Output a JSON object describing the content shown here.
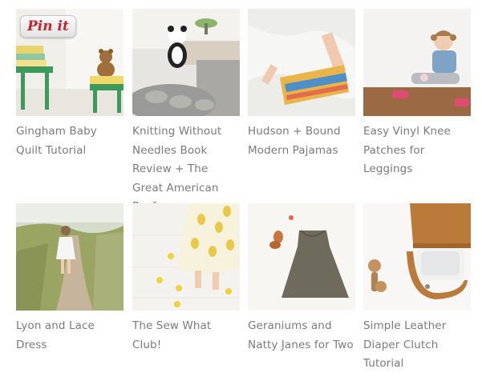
{
  "pin_button": {
    "label": "Pin it"
  },
  "cards": [
    {
      "title": "Gingham Baby Quilt Tutorial"
    },
    {
      "title": "Knitting Without Needles Book Review + The Great American Pouf"
    },
    {
      "title": "Hudson + Bound Modern Pajamas"
    },
    {
      "title": "Easy Vinyl Knee Patches for Leggings"
    },
    {
      "title": "Lyon and Lace Dress"
    },
    {
      "title": "The Sew What Club!"
    },
    {
      "title": "Geraniums and Natty Janes for Two"
    },
    {
      "title": "Simple Leather Diaper Clutch Tutorial"
    }
  ]
}
